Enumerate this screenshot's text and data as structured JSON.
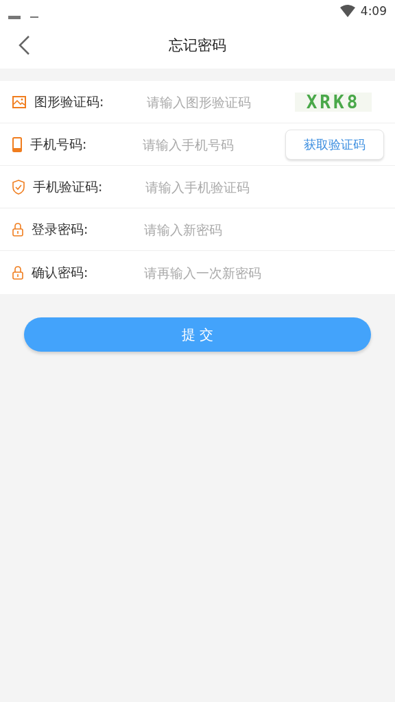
{
  "status_bar": {
    "time": "4:09"
  },
  "header": {
    "title": "忘记密码"
  },
  "form_rows": [
    {
      "kind": "image",
      "label": "图形验证码:",
      "placeholder": "请输入图形验证码",
      "captcha": "XRK8"
    },
    {
      "kind": "phone",
      "label": "手机号码:",
      "placeholder": "请输入手机号码",
      "button": "获取验证码"
    },
    {
      "kind": "shield",
      "label": "手机验证码:",
      "placeholder": "请输入手机验证码"
    },
    {
      "kind": "lock",
      "label": "登录密码:",
      "placeholder": "请输入新密码"
    },
    {
      "kind": "lock",
      "label": "确认密码:",
      "placeholder": "请再输入一次新密码"
    }
  ],
  "submit_button": "提 交"
}
